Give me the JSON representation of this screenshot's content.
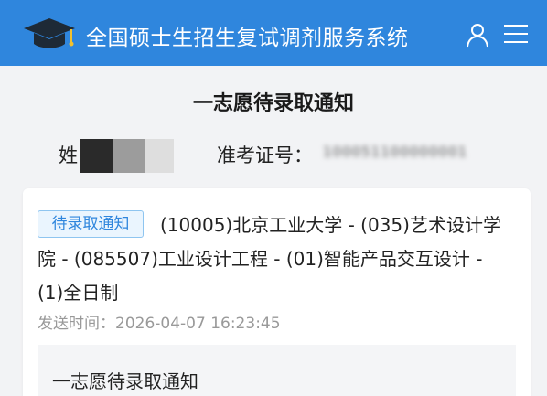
{
  "header": {
    "app_title": "全国硕士生招生复试调剂服务系统",
    "logo_icon": "graduation-cap-icon",
    "user_icon": "user-icon",
    "menu_icon": "hamburger-menu-icon",
    "background_color": "#2f86dd"
  },
  "page": {
    "title": "一志愿待录取通知"
  },
  "candidate": {
    "name_label": "姓",
    "exam_number_label": "准考证号：",
    "exam_number_value": "100051100000001"
  },
  "notice": {
    "status_badge": "待录取通知",
    "program": "(10005)北京工业大学 - (035)艺术设计学院 - (085507)工业设计工程 - (01)智能产品交互设计 - (1)全日制",
    "send_time": "发送时间：2026-04-07 16:23:45",
    "detail_title": "一志愿待录取通知",
    "badge_color": "#2f86dd"
  }
}
